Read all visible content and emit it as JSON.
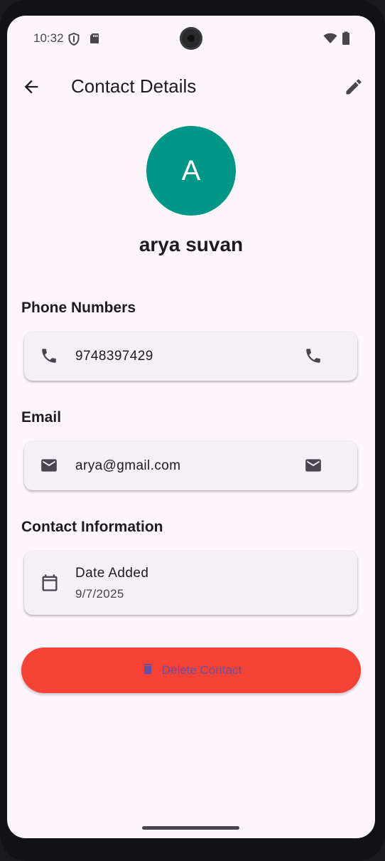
{
  "status_bar": {
    "time": "10:32"
  },
  "app_bar": {
    "title": "Contact Details",
    "back_icon": "arrow-back-icon",
    "edit_icon": "pencil-icon"
  },
  "contact": {
    "avatar_initial": "A",
    "avatar_color": "#009688",
    "name": "arya suvan"
  },
  "sections": {
    "phone": {
      "title": "Phone Numbers",
      "number": "9748397429",
      "icon": "phone-icon",
      "action_icon": "phone-icon"
    },
    "email": {
      "title": "Email",
      "address": "arya@gmail.com",
      "icon": "mail-icon",
      "action_icon": "mail-icon"
    },
    "info": {
      "title": "Contact Information",
      "date_label": "Date Added",
      "date_value": "9/7/2025",
      "icon": "calendar-icon"
    }
  },
  "delete_button": {
    "label": "Delete Contact",
    "icon": "trash-icon",
    "background": "#f44336",
    "text_color": "#6750a4"
  }
}
